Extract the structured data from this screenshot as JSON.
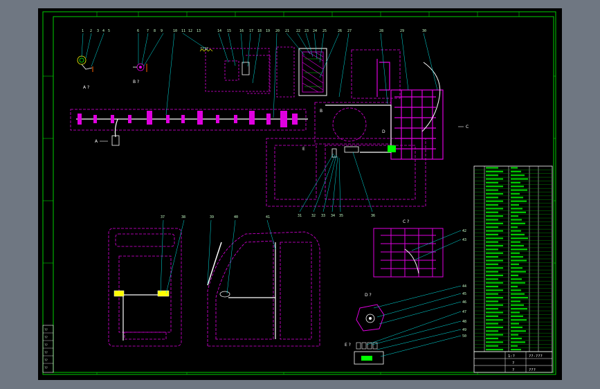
{
  "drawing": {
    "views": {
      "a": "A ?",
      "b": "B ?",
      "c": "C ?",
      "d": "D ?",
      "e": "E ?",
      "arrow_a": "A",
      "arrow_b": "B",
      "arrow_c": "C",
      "arrow_d": "D",
      "arrow_e": "E"
    },
    "callouts_top": [
      "1",
      "2",
      "3",
      "4",
      "5",
      "6",
      "7",
      "8",
      "9",
      "10",
      "11",
      "12",
      "13",
      "14",
      "15",
      "16",
      "17",
      "18",
      "19",
      "20",
      "21",
      "22",
      "23",
      "24",
      "25",
      "26",
      "27",
      "28",
      "29",
      "30"
    ],
    "callouts_bottom": [
      "31",
      "32",
      "33",
      "34",
      "35",
      "36"
    ],
    "callouts_lower": [
      "37",
      "38",
      "39",
      "40",
      "41"
    ],
    "callouts_right": [
      "42",
      "43",
      "44",
      "45",
      "46",
      "47",
      "48",
      "49",
      "50"
    ],
    "spring_note": "????"
  },
  "title_block": {
    "drawing_no": "??-???",
    "scale": "1:?",
    "material": "?",
    "sheet": "?",
    "company": "???"
  },
  "left_table": [
    "??",
    "??",
    "??",
    "??",
    "??",
    "??"
  ]
}
